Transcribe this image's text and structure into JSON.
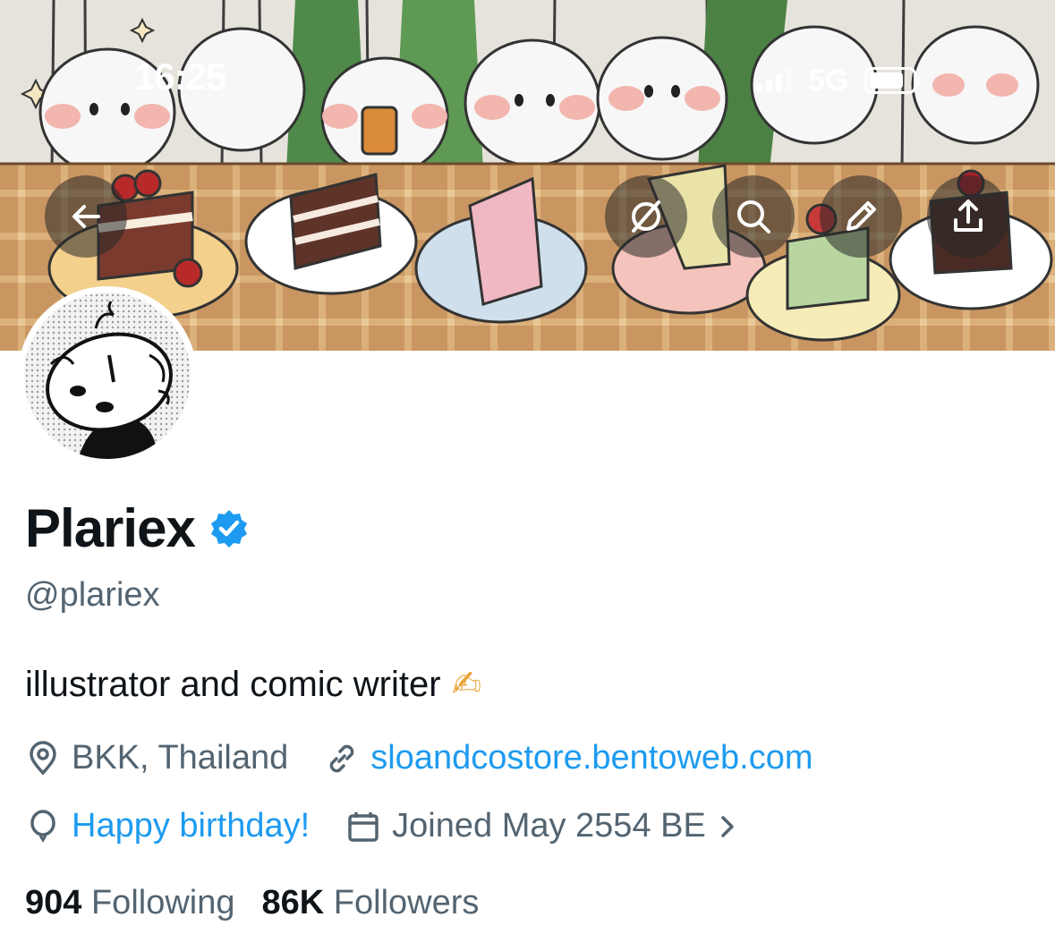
{
  "status_bar": {
    "time": "16:25",
    "network": "5G"
  },
  "toolbar": {
    "back_icon": "arrow-left-icon",
    "hide_icon": "eye-off-icon",
    "search_icon": "search-icon",
    "edit_icon": "pencil-icon",
    "share_icon": "share-icon"
  },
  "profile": {
    "name": "Plariex",
    "verified": true,
    "handle": "@plariex",
    "bio": "illustrator and comic writer",
    "bio_emoji": "✍",
    "location": "BKK, Thailand",
    "website": "sloandcostore.bentoweb.com",
    "birthday": "Happy birthday!",
    "joined": "Joined May 2554 BE",
    "following_count": "904",
    "following_label": "Following",
    "followers_count": "86K",
    "followers_label": "Followers"
  },
  "colors": {
    "link": "#1d9bf0",
    "verified": "#1d9bf0",
    "secondary_text": "#536471"
  }
}
